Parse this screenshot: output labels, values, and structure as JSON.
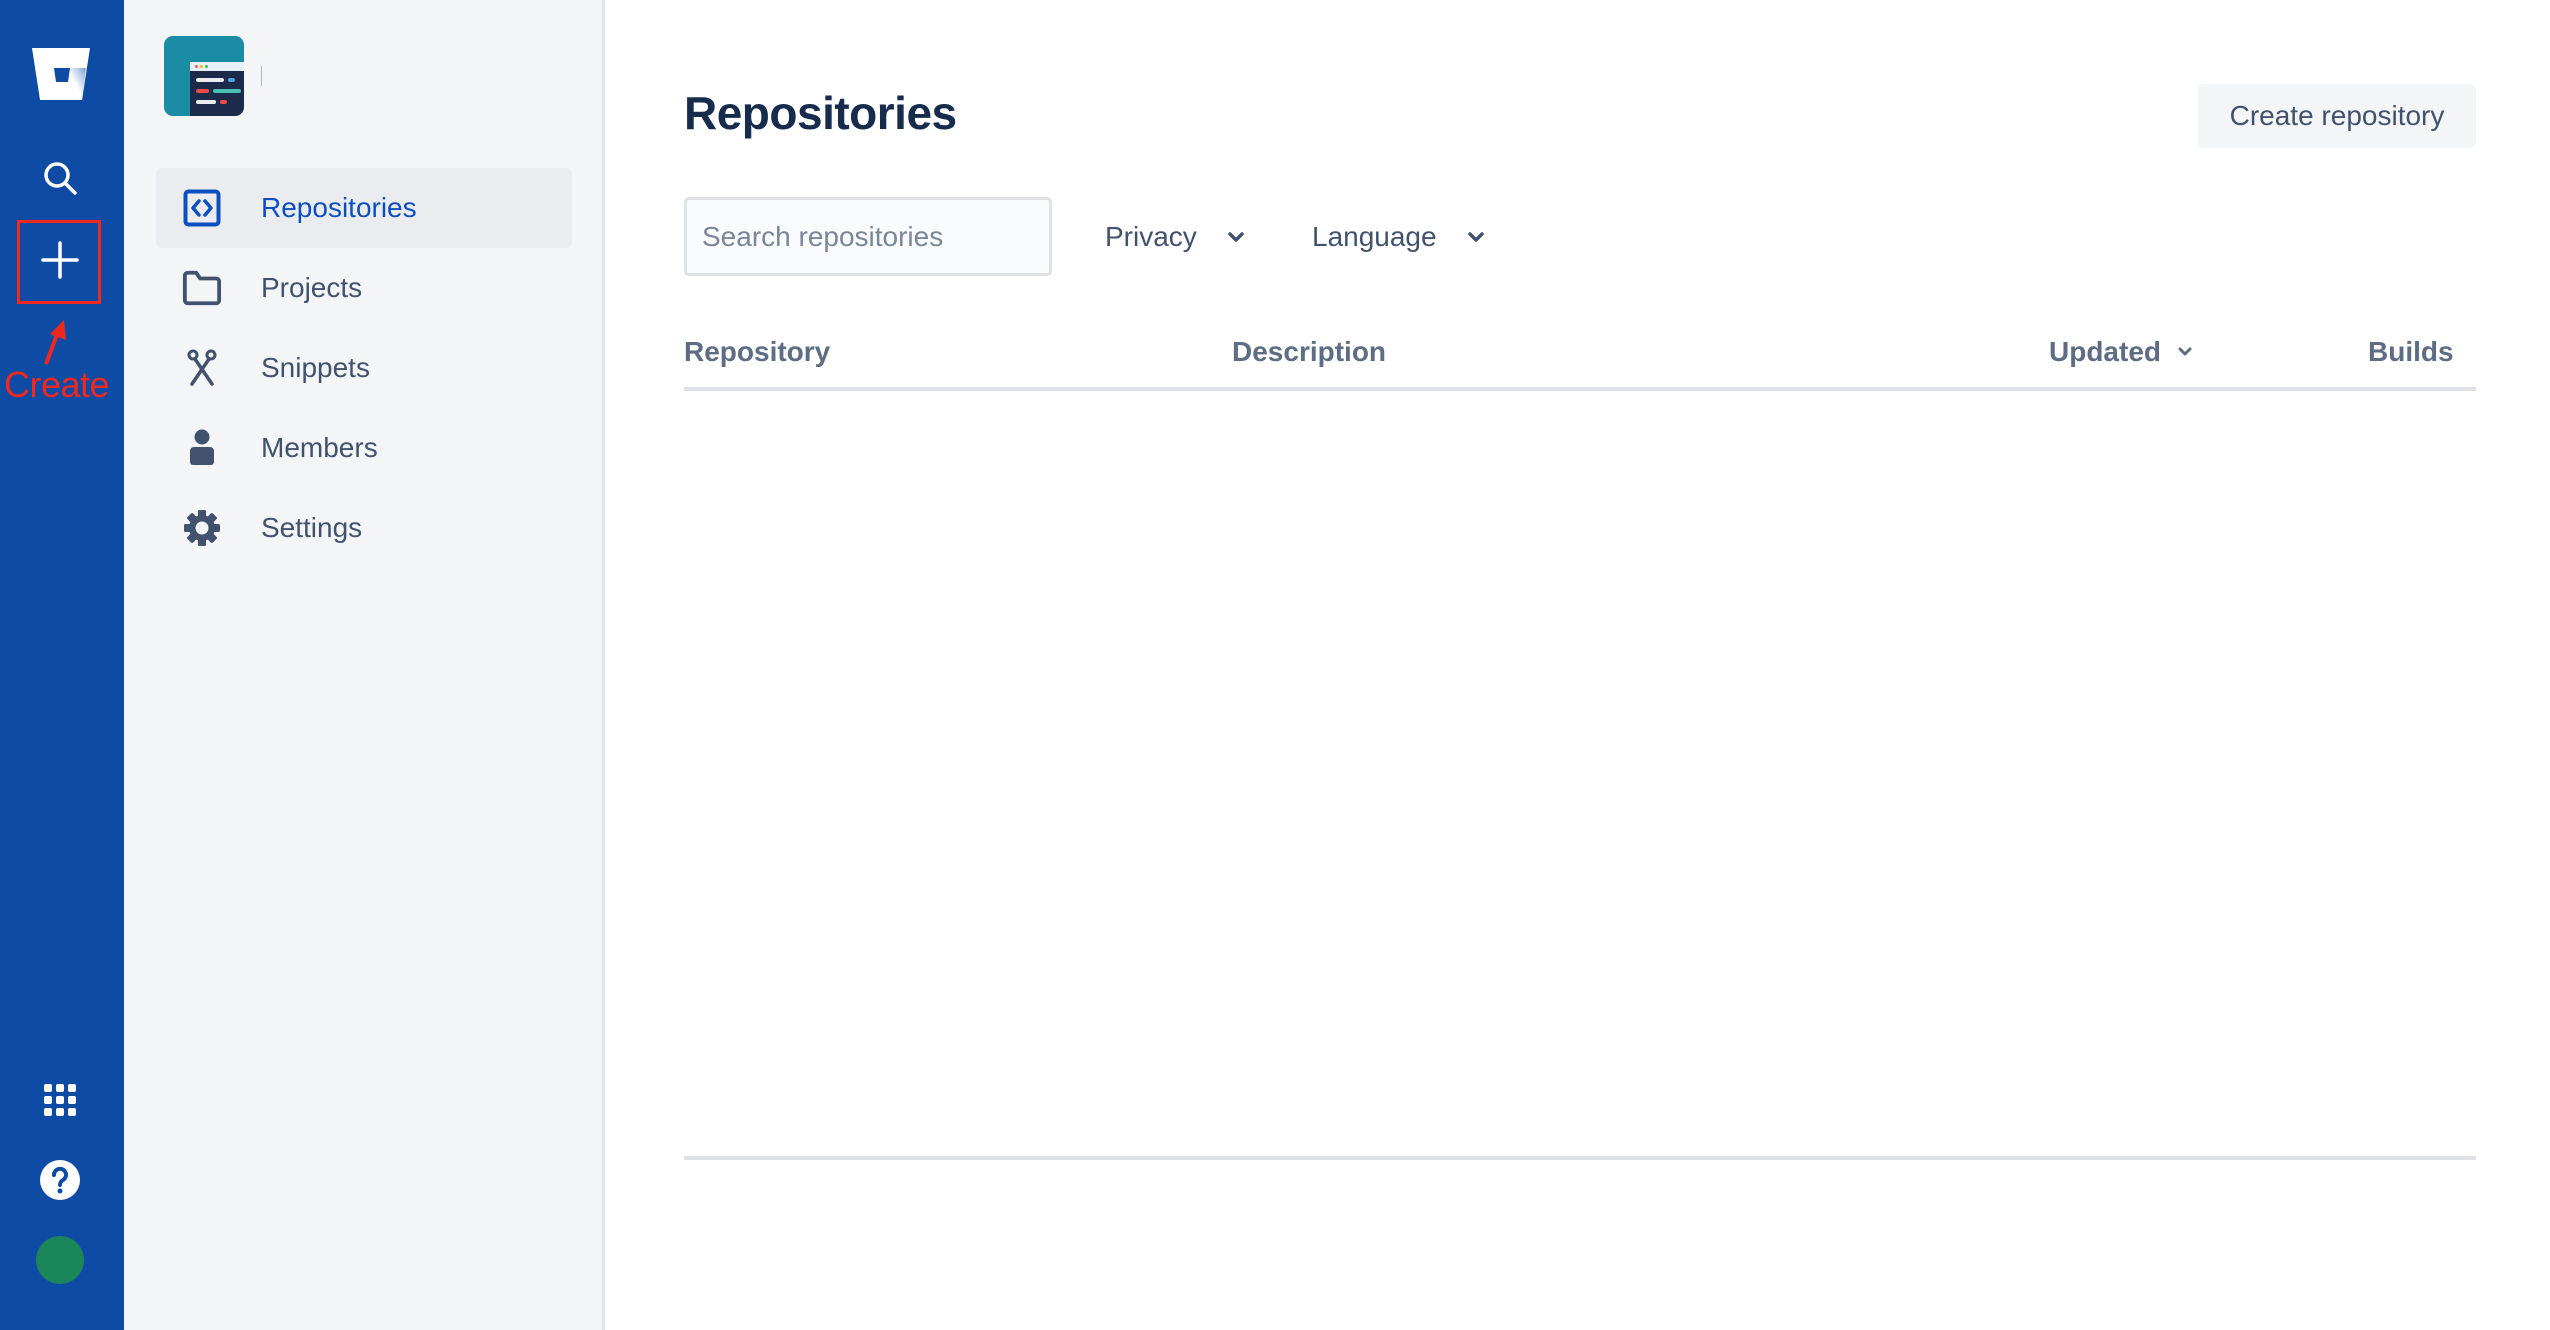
{
  "global_nav": {
    "icons": [
      "bitbucket-logo-icon",
      "search-icon",
      "plus-icon",
      "app-switcher-icon",
      "help-icon",
      "avatar"
    ],
    "avatar_color": "#1B8659",
    "background": "#0E4BA5"
  },
  "annotation": {
    "label": "Create",
    "color": "#F0281E"
  },
  "sidebar": {
    "items": [
      {
        "label": "Repositories",
        "icon": "code-icon",
        "active": true
      },
      {
        "label": "Projects",
        "icon": "folder-icon",
        "active": false
      },
      {
        "label": "Snippets",
        "icon": "scissors-icon",
        "active": false
      },
      {
        "label": "Members",
        "icon": "person-icon",
        "active": false
      },
      {
        "label": "Settings",
        "icon": "gear-icon",
        "active": false
      }
    ]
  },
  "main": {
    "title": "Repositories",
    "create_button": "Create repository",
    "search": {
      "placeholder": "Search repositories",
      "value": ""
    },
    "filters": [
      {
        "label": "Privacy"
      },
      {
        "label": "Language"
      }
    ],
    "table": {
      "columns": [
        "Repository",
        "Description",
        "Updated",
        "Builds"
      ],
      "sorted_by": "Updated",
      "rows": []
    }
  }
}
